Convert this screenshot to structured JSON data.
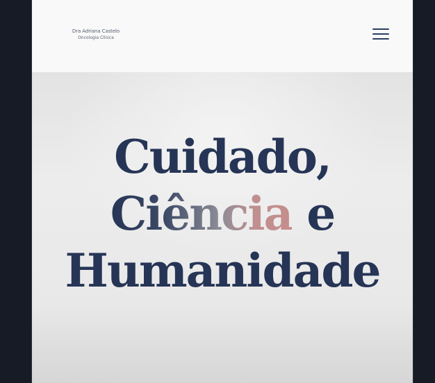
{
  "header": {
    "logo_line1": "Dra Adriana Castelo",
    "logo_line2": "Oncologia Clínica",
    "menu_icon": "hamburger-menu-icon"
  },
  "hero": {
    "line1": "Cuidado,",
    "line2_word": "Ciência",
    "line2_rest": " e",
    "line3": "Humanidade"
  },
  "colors": {
    "page_background": "#161b26",
    "header_background": "#f9f9f9",
    "hero_background": "#ececec",
    "headline_navy": "#263556",
    "accent_rose": "#c48e8c"
  }
}
